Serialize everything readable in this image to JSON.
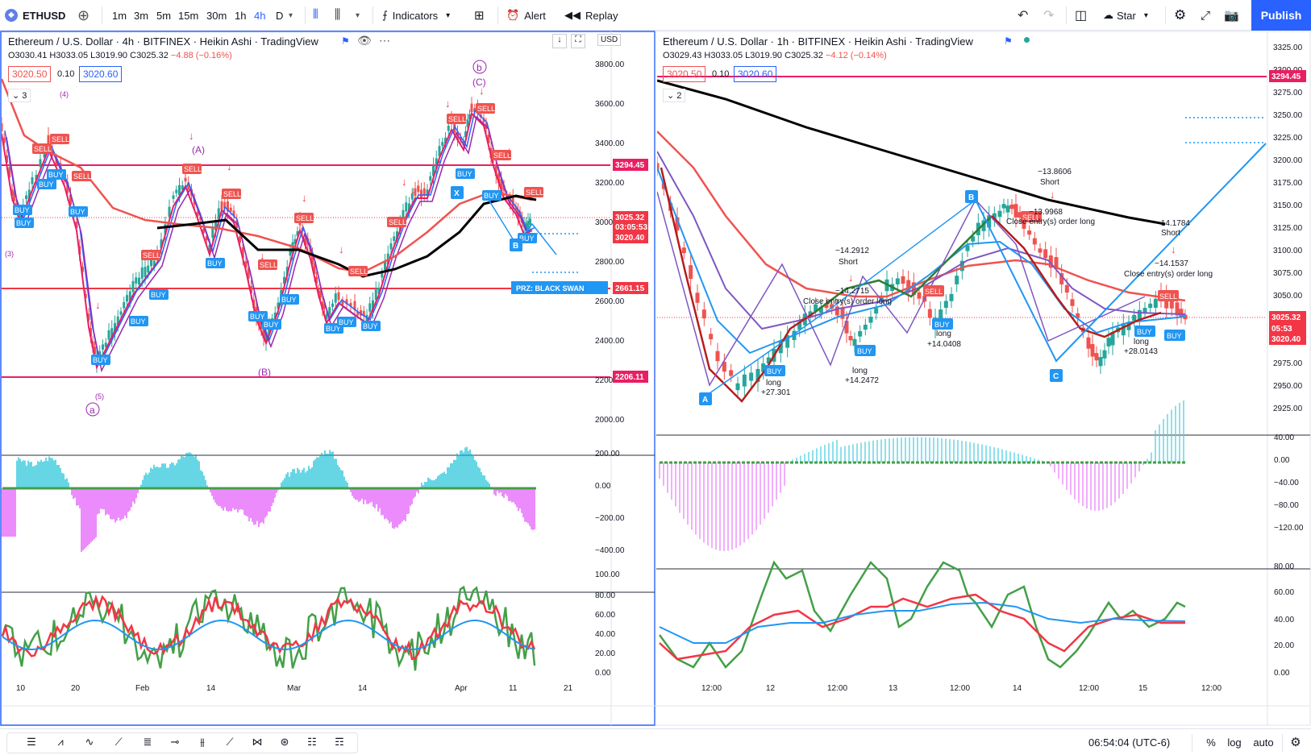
{
  "toolbar": {
    "symbol": "ETHUSD",
    "intervals": [
      "1m",
      "3m",
      "5m",
      "15m",
      "30m",
      "1h",
      "4h",
      "D"
    ],
    "active_interval": "4h",
    "indicators": "Indicators",
    "alert": "Alert",
    "replay": "Replay",
    "star": "Star",
    "publish": "Publish"
  },
  "left": {
    "title": "Ethereum / U.S. Dollar · 4h · BITFINEX · Heikin Ashi · TradingView",
    "ohlc": {
      "o": "O3030.41",
      "h": "H3033.05",
      "l": "L3019.90",
      "c": "C3025.32",
      "chg": "−4.88 (−0.16%)"
    },
    "bid": "3020.50",
    "spread": "0.10",
    "ask": "3020.60",
    "collapse": "3",
    "currency": "USD",
    "y_labels": [
      "3800.00",
      "3600.00",
      "3400.00",
      "3200.00",
      "3000.00",
      "2800.00",
      "2600.00",
      "2400.00",
      "2200.00",
      "2000.00"
    ],
    "price_tags": {
      "a": "3294.45",
      "b": "2661.15",
      "c": "2206.11",
      "cur": "3025.32",
      "timer": "03:05:53",
      "bidtag": "3020.40"
    },
    "osc1_labels": [
      "200.00",
      "0.00",
      "−200.00",
      "−400.00"
    ],
    "osc2_labels": [
      "100.00",
      "80.00",
      "60.00",
      "40.00",
      "20.00",
      "0.00"
    ],
    "x_labels": [
      "10",
      "20",
      "Feb",
      "14",
      "Mar",
      "14",
      "Apr",
      "11",
      "21"
    ],
    "wave": {
      "b_small": "b",
      "C": "(C)",
      "A": "(A)",
      "B": "(B)",
      "a_small": "a",
      "w4": "(4)",
      "w3": "(3)",
      "w5": "(5)"
    },
    "marks": {
      "buy": "BUY",
      "sell": "SELL",
      "x": "X",
      "b": "B",
      "prz": "PRZ: BLACK SWAN"
    }
  },
  "right": {
    "title": "Ethereum / U.S. Dollar · 1h · BITFINEX · Heikin Ashi · TradingView",
    "ohlc": {
      "o": "O3029.43",
      "h": "H3033.05",
      "l": "L3019.90",
      "c": "C3025.32",
      "chg": "−4.12 (−0.14%)"
    },
    "bid": "3020.50",
    "spread": "0.10",
    "ask": "3020.60",
    "collapse": "2",
    "y_labels": [
      "3325.00",
      "3300.00",
      "3275.00",
      "3250.00",
      "3225.00",
      "3200.00",
      "3175.00",
      "3150.00",
      "3125.00",
      "3100.00",
      "3075.00",
      "3050.00",
      "3025.00",
      "3000.00",
      "2975.00",
      "2950.00",
      "2925.00"
    ],
    "price_tags": {
      "a": "3294.45",
      "cur": "3025.32",
      "timer": "05:53",
      "bidtag": "3020.40"
    },
    "osc1_labels": [
      "40.00",
      "0.00",
      "−40.00",
      "−80.00",
      "−120.00"
    ],
    "osc2_labels": [
      "80.00",
      "60.00",
      "40.00",
      "20.00",
      "0.00"
    ],
    "x_labels": [
      "12:00",
      "12",
      "12:00",
      "13",
      "12:00",
      "14",
      "12:00",
      "15",
      "12:00"
    ],
    "pts": {
      "A": "A",
      "B": "B",
      "C": "C"
    },
    "notes": {
      "n1": "−13.8606",
      "n1b": "Short",
      "n2": "−13.9968",
      "n2b": "Close entry(s) order long",
      "n3": "−14.2912",
      "n3b": "Short",
      "n4": "−14.2715",
      "n4b": "Close entry(s) order long",
      "n5": "long",
      "n5b": "+27.301",
      "n6": "long",
      "n6b": "+14.2472",
      "n7": "long",
      "n7b": "+14.0408",
      "n8": "long",
      "n8b": "+28.0143",
      "n9": "−14.1784",
      "n9b": "Short",
      "n10": "−14.1537",
      "n10b": "Close entry(s) order long"
    },
    "marks": {
      "buy": "BUY",
      "sell": "SELL"
    }
  },
  "bottom": {
    "time": "06:54:04 (UTC-6)",
    "pct": "%",
    "log": "log",
    "auto": "auto"
  }
}
